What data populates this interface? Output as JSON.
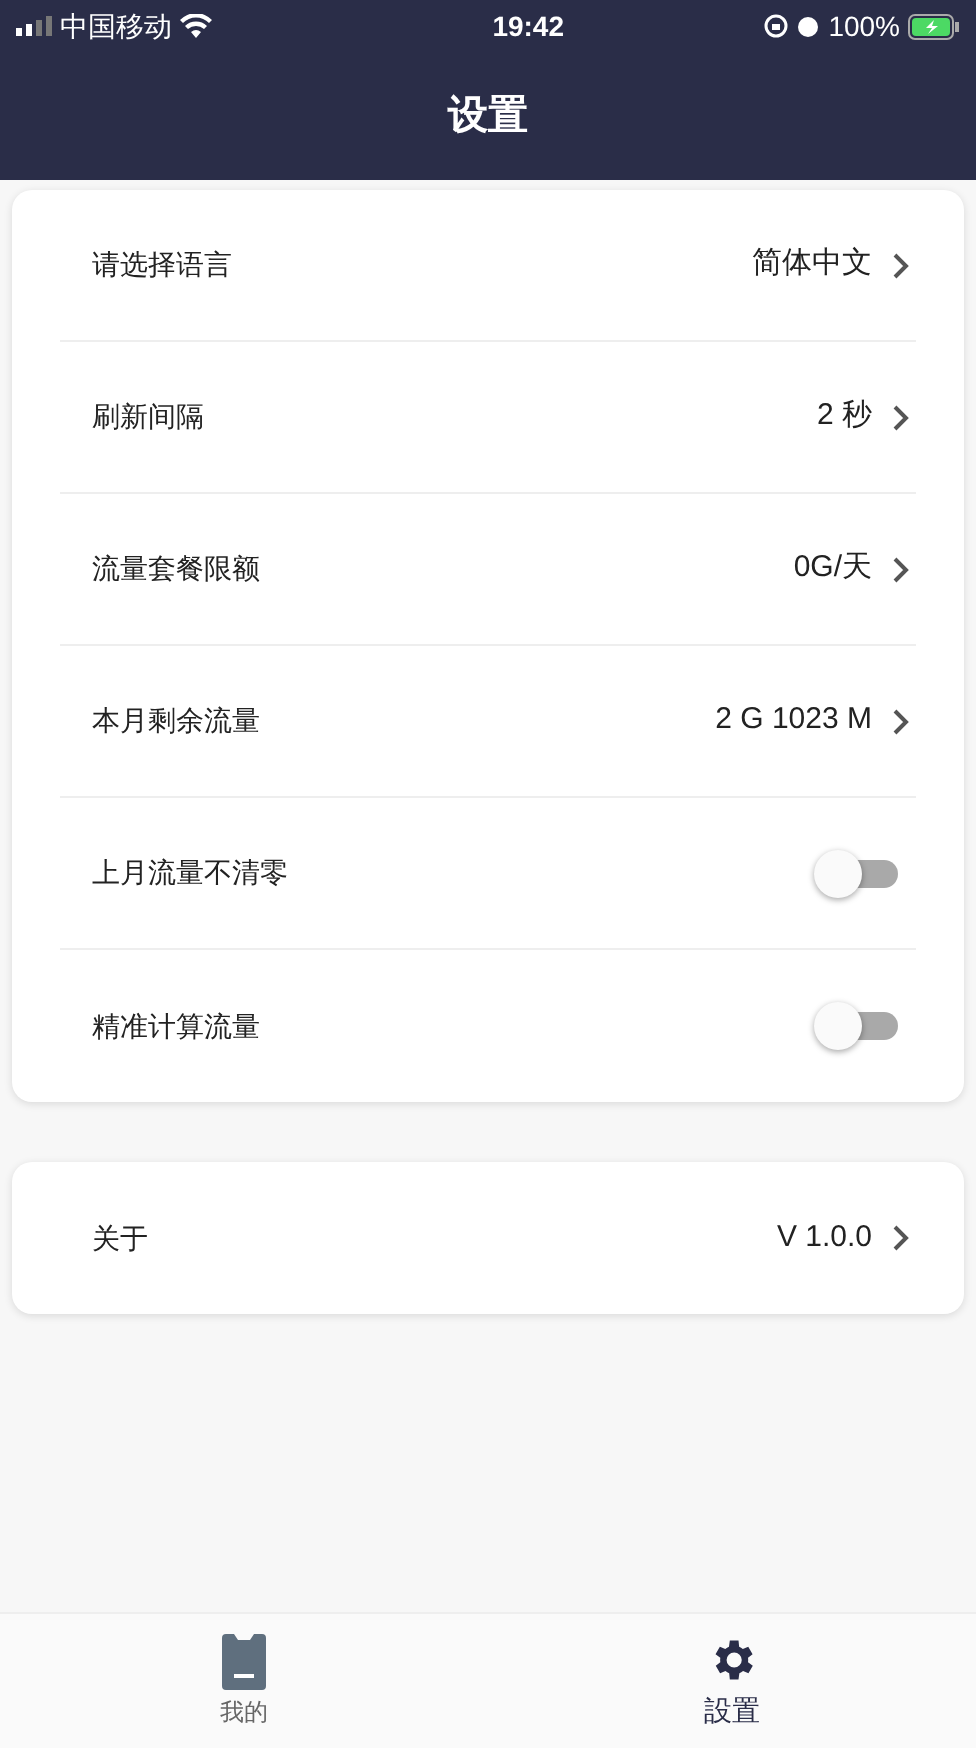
{
  "status_bar": {
    "carrier": "中国移动",
    "time": "19:42",
    "battery": "100%"
  },
  "header": {
    "title": "设置"
  },
  "settings": [
    {
      "kind": "link",
      "label": "请选择语言",
      "value": "简体中文"
    },
    {
      "kind": "link",
      "label": "刷新间隔",
      "value": "2 秒"
    },
    {
      "kind": "link",
      "label": "流量套餐限额",
      "value": "0G/天"
    },
    {
      "kind": "link",
      "label": "本月剩余流量",
      "value": "2 G 1023 M"
    },
    {
      "kind": "toggle",
      "label": "上月流量不清零",
      "on": false
    },
    {
      "kind": "toggle",
      "label": "精准计算流量",
      "on": false
    }
  ],
  "about": [
    {
      "kind": "link",
      "label": "关于",
      "value": "V 1.0.0"
    }
  ],
  "tab_bar": [
    {
      "label": "我的",
      "selected": false
    },
    {
      "label": "設置",
      "selected": true
    }
  ]
}
